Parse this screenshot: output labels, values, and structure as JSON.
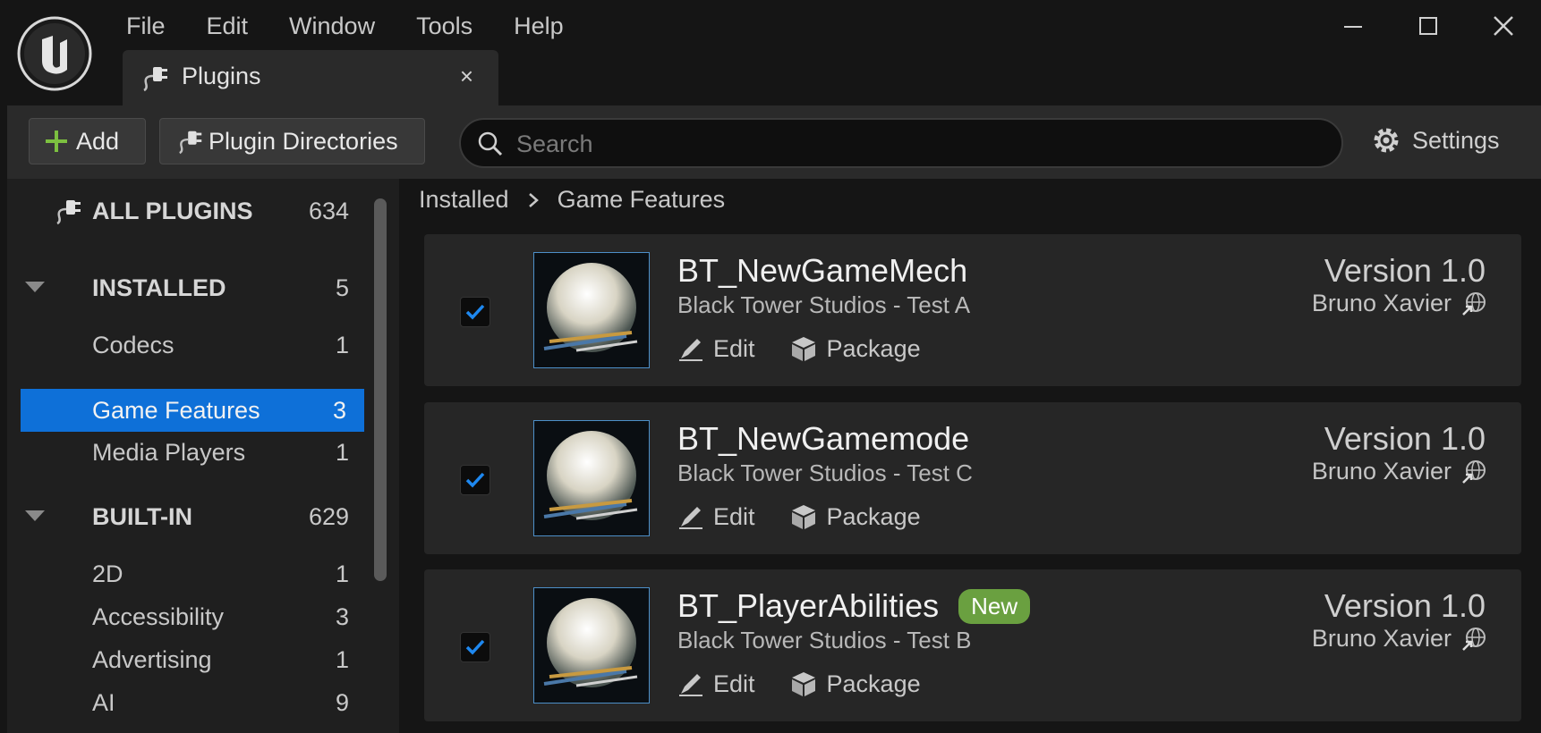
{
  "menu": [
    "File",
    "Edit",
    "Window",
    "Tools",
    "Help"
  ],
  "tab": {
    "label": "Plugins",
    "close": "×"
  },
  "toolbar": {
    "add_label": "Add",
    "dirs_label": "Plugin Directories",
    "search_placeholder": "Search",
    "settings_label": "Settings"
  },
  "sidebar": {
    "all": {
      "label": "ALL PLUGINS",
      "count": "634"
    },
    "installed": {
      "label": "INSTALLED",
      "count": "5"
    },
    "installed_items": [
      {
        "label": "Codecs",
        "count": "1"
      },
      {
        "label": "Game Features",
        "count": "3"
      },
      {
        "label": "Media Players",
        "count": "1"
      }
    ],
    "builtin": {
      "label": "BUILT-IN",
      "count": "629"
    },
    "builtin_items": [
      {
        "label": "2D",
        "count": "1"
      },
      {
        "label": "Accessibility",
        "count": "3"
      },
      {
        "label": "Advertising",
        "count": "1"
      },
      {
        "label": "AI",
        "count": "9"
      }
    ]
  },
  "breadcrumb": {
    "root": "Installed",
    "current": "Game Features"
  },
  "plugins": [
    {
      "name": "BT_NewGameMech",
      "desc": "Black Tower Studios - Test A",
      "version": "Version 1.0",
      "author": "Bruno Xavier",
      "edit": "Edit",
      "package": "Package",
      "badge": ""
    },
    {
      "name": "BT_NewGamemode",
      "desc": "Black Tower Studios - Test C",
      "version": "Version 1.0",
      "author": "Bruno Xavier",
      "edit": "Edit",
      "package": "Package",
      "badge": ""
    },
    {
      "name": "BT_PlayerAbilities",
      "desc": "Black Tower Studios - Test B",
      "version": "Version 1.0",
      "author": "Bruno Xavier",
      "edit": "Edit",
      "package": "Package",
      "badge": "New"
    }
  ],
  "colors": {
    "accent": "#0e70d8",
    "badge": "#6aa040",
    "add_icon": "#7cc040"
  }
}
